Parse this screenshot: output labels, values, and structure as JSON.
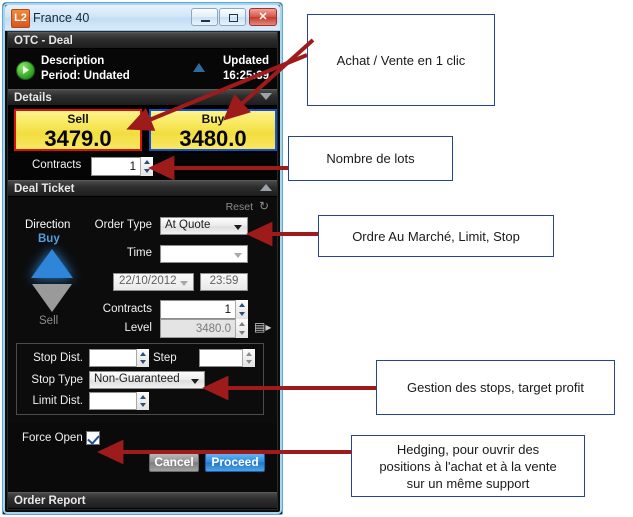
{
  "window": {
    "title": "France 40",
    "icon_label": "L2",
    "controls": {
      "minimize": "minimize-button",
      "maximize": "maximize-button",
      "close": "close-button"
    }
  },
  "sections": {
    "otc_deal": "OTC - Deal",
    "details": "Details",
    "deal_ticket": "Deal Ticket",
    "order_report": "Order Report"
  },
  "info": {
    "description": "Description",
    "period": "Period:  Undated",
    "updated_label": "Updated",
    "updated_time": "16:25:39"
  },
  "prices": {
    "sell_label": "Sell",
    "sell_value": "3479.0",
    "sell_border_color": "#d81212",
    "buy_label": "Buy",
    "buy_value": "3480.0",
    "buy_border_color": "#1653c8",
    "background_color": "#f7e657"
  },
  "contracts_top": {
    "label": "Contracts",
    "value": "1"
  },
  "ticket": {
    "reset_label": "Reset",
    "reset_icon": "refresh-icon",
    "direction_label": "Direction",
    "direction_buy": "Buy",
    "direction_sell": "Sell",
    "order_type_label": "Order Type",
    "order_type_value": "At Quote",
    "time_label": "Time",
    "time_value": "",
    "date_value": "22/10/2012",
    "clock_value": "23:59",
    "contracts_label": "Contracts",
    "contracts_value": "1",
    "level_label": "Level",
    "level_value": "3480.0",
    "ladder_icon": "ladder-icon"
  },
  "stops": {
    "stop_dist_label": "Stop Dist.",
    "stop_dist_value": "",
    "step_label": "Step",
    "step_value": "",
    "stop_type_label": "Stop Type",
    "stop_type_value": "Non-Guaranteed",
    "limit_dist_label": "Limit Dist.",
    "limit_dist_value": ""
  },
  "footer": {
    "force_open_label": "Force Open",
    "force_open_checked": "checked",
    "cancel_label": "Cancel",
    "proceed_label": "Proceed"
  },
  "callouts": [
    {
      "text": "Achat / Vente en 1 clic"
    },
    {
      "text": "Nombre de lots"
    },
    {
      "text": "Ordre Au Marché, Limit, Stop"
    },
    {
      "text": "Gestion des stops, target profit"
    },
    {
      "line1": "Hedging, pour ouvrir des",
      "line2": "positions à l'achat et à la vente",
      "line3": "sur un même support"
    }
  ],
  "colors": {
    "annotation_arrow": "#9e1b1b",
    "callout_border": "#26429a"
  }
}
